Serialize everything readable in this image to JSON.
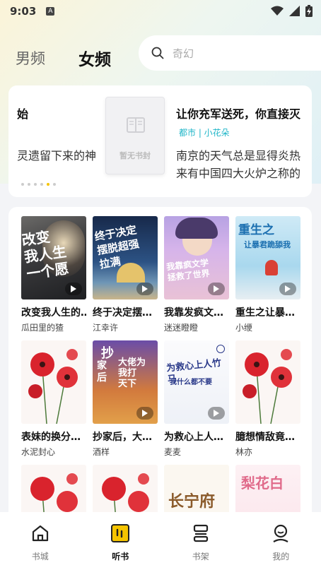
{
  "status_bar": {
    "time": "9:03",
    "indicator": "A"
  },
  "header": {
    "tabs": [
      {
        "label": "男频"
      },
      {
        "label": "女频"
      }
    ],
    "search_placeholder": "奇幻"
  },
  "banner": {
    "left": {
      "title": "始",
      "desc": "灵遗留下来的神"
    },
    "cover_placeholder": "暂无书封",
    "right": {
      "title": "让你充军送死，你直接灭",
      "tag": "都市 | 小花朵",
      "desc_line1": "南京的天气总是显得炎热",
      "desc_line2": "来有中国四大火炉之称的"
    }
  },
  "books": [
    {
      "title": "改变我人生的…",
      "author": "瓜田里的猹",
      "cover_text": "改变我人生的一个愿望"
    },
    {
      "title": "终于决定摆…",
      "author": "江幸许",
      "cover_text": "终于决定摆烂超强拉满"
    },
    {
      "title": "我靠发疯文…",
      "author": "迷迷瞪瞪",
      "cover_text": "我靠疯文学拯救了世界"
    },
    {
      "title": "重生之让暴…",
      "author": "小缏",
      "cover_text": "重生之让暴君跪舔我"
    },
    {
      "title": "表妹的换分…",
      "author": "水泥封心",
      "cover_text": ""
    },
    {
      "title": "抄家后，大…",
      "author": "酒样",
      "cover_text": "抄家后大佬为我打天下"
    },
    {
      "title": "为救心上人…",
      "author": "麦麦",
      "cover_text": "为救心上人竹马我什么都不要"
    },
    {
      "title": "臆想情敌竟…",
      "author": "林亦",
      "cover_text": ""
    },
    {
      "title": "",
      "author": "",
      "cover_text": ""
    },
    {
      "title": "",
      "author": "",
      "cover_text": ""
    },
    {
      "title": "",
      "author": "",
      "cover_text": "长宁府"
    },
    {
      "title": "",
      "author": "",
      "cover_text": "梨花白"
    }
  ],
  "tabbar": [
    {
      "label": "书城",
      "icon": "home-icon"
    },
    {
      "label": "听书",
      "icon": "audio-book-icon"
    },
    {
      "label": "书架",
      "icon": "bookshelf-icon"
    },
    {
      "label": "我的",
      "icon": "profile-icon"
    }
  ],
  "colors": {
    "accent": "#f5c400",
    "tag": "#20b6c8"
  }
}
